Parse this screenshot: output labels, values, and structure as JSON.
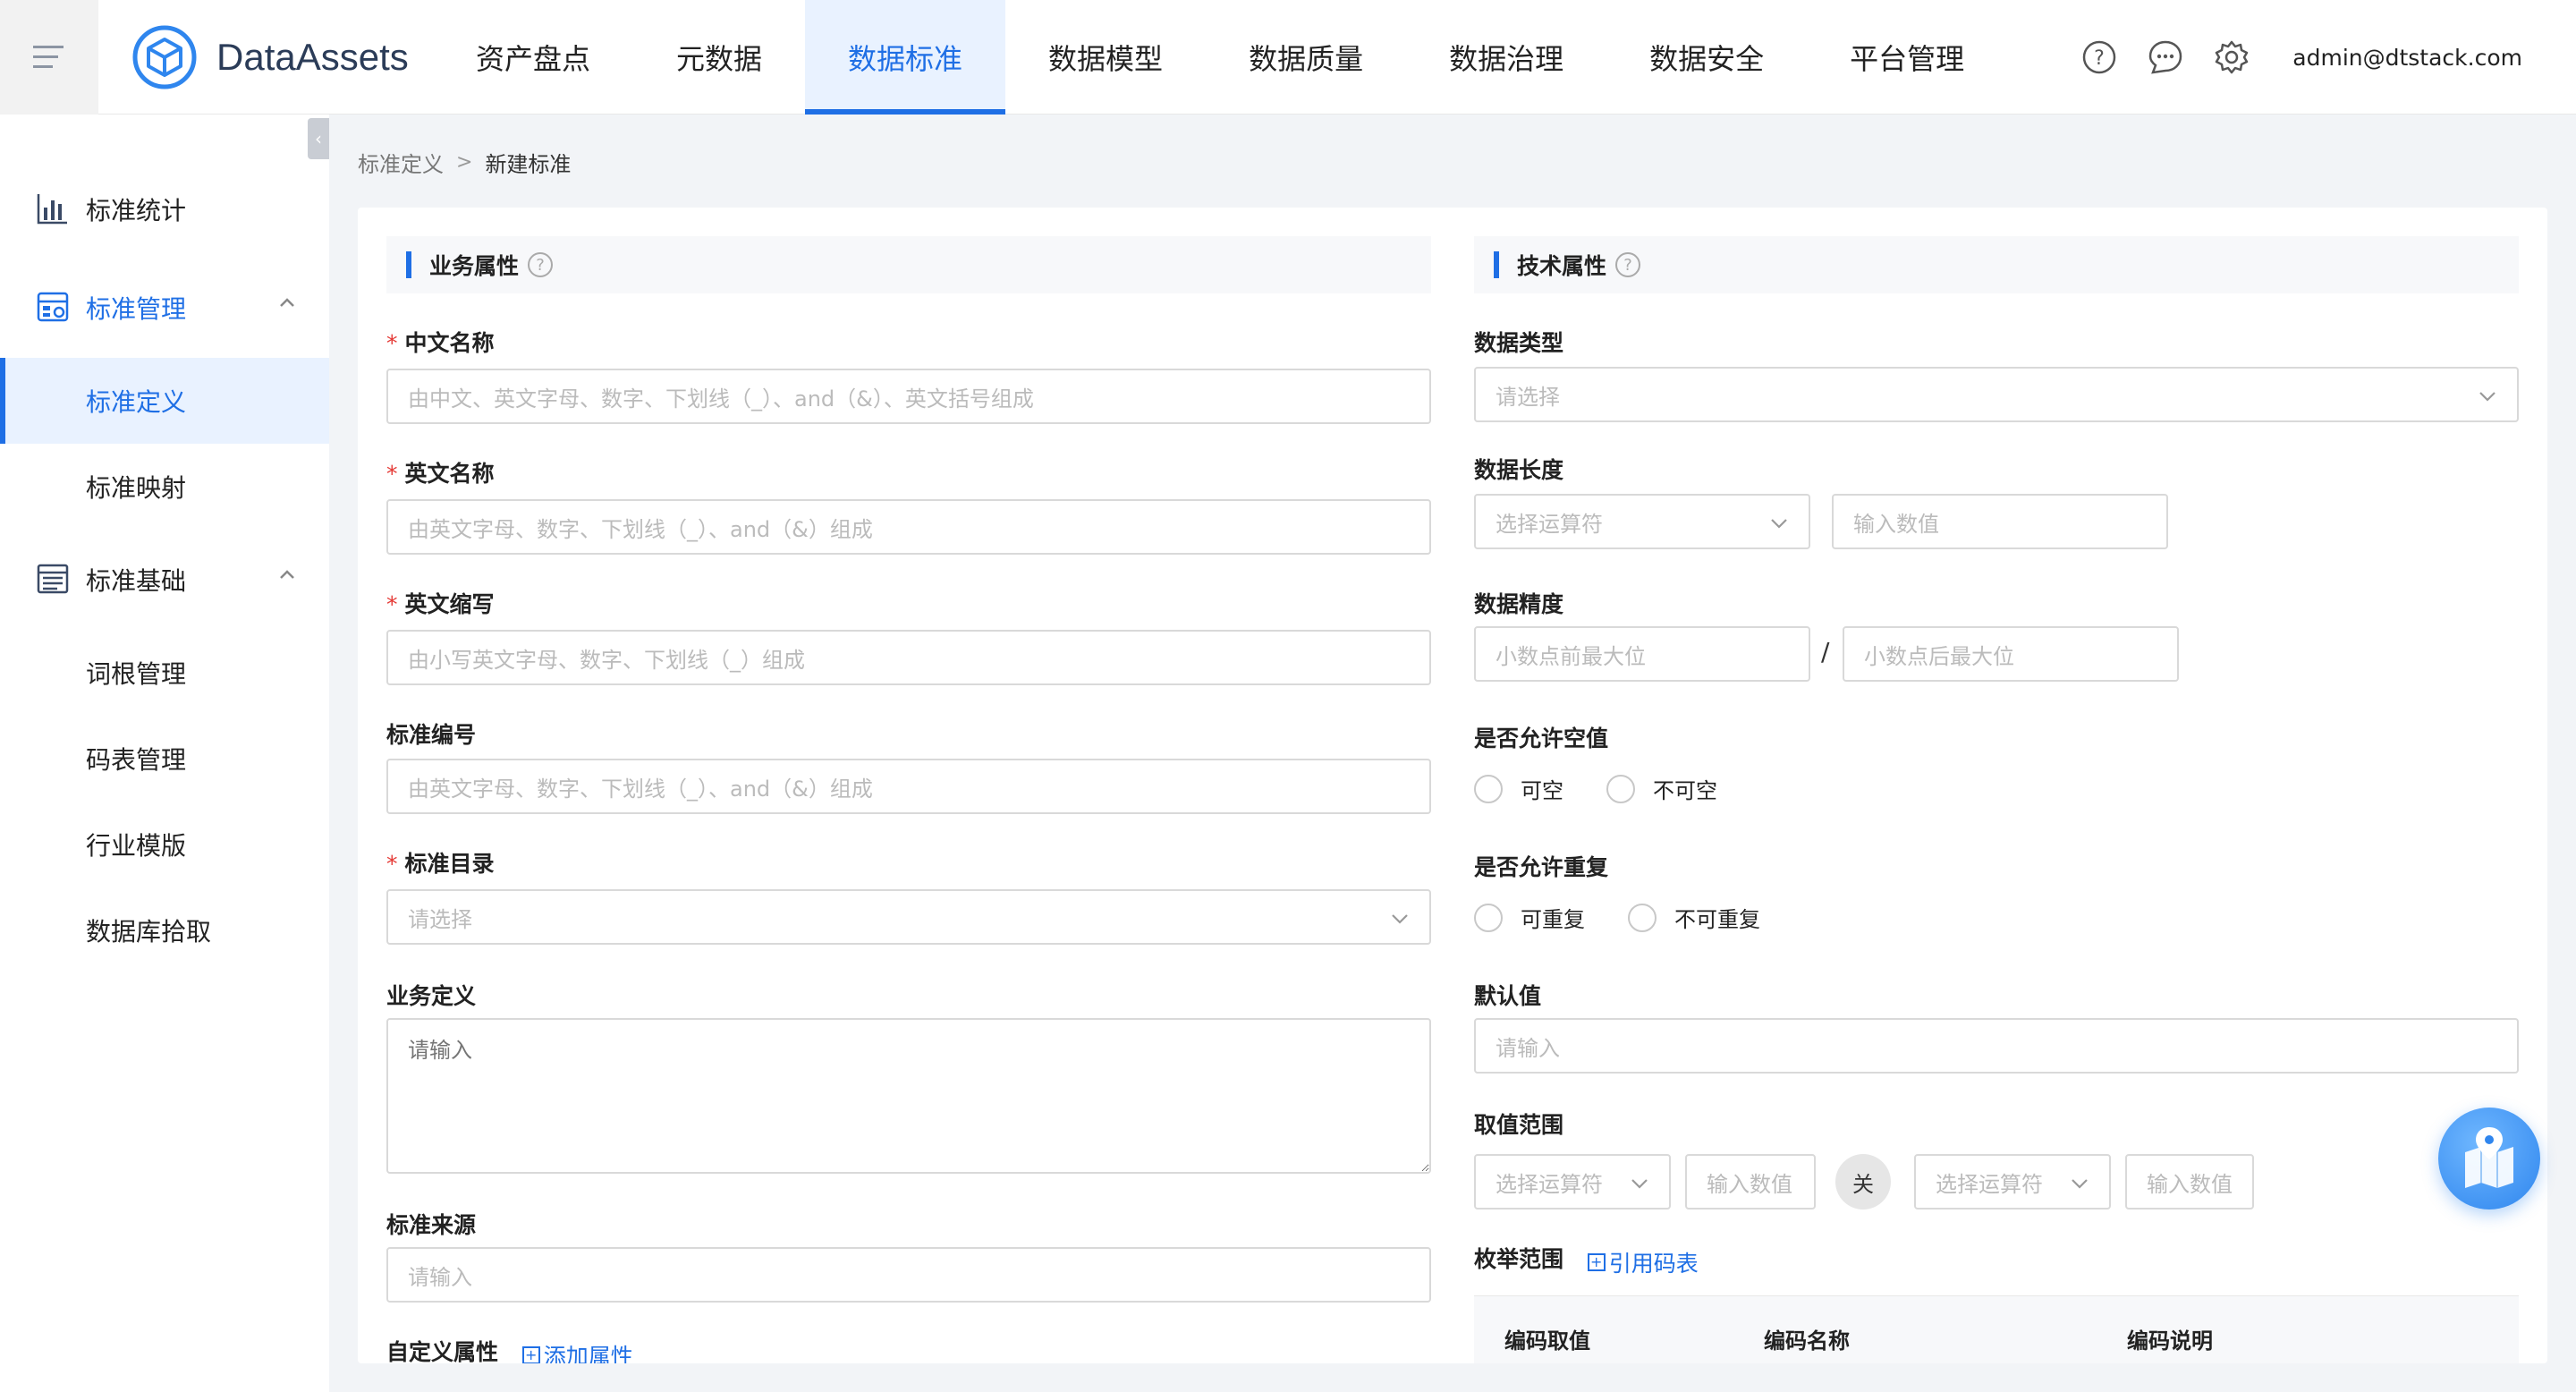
{
  "app": {
    "name": "DataAssets",
    "user": "admin@dtstack.com"
  },
  "nav": [
    "资产盘点",
    "元数据",
    "数据标准",
    "数据模型",
    "数据质量",
    "数据治理",
    "数据安全",
    "平台管理"
  ],
  "nav_active": "数据标准",
  "sidebar": {
    "items": [
      {
        "label": "标准统计"
      },
      {
        "label": "标准管理"
      },
      {
        "label": "标准定义"
      },
      {
        "label": "标准映射"
      },
      {
        "label": "标准基础"
      },
      {
        "label": "词根管理"
      },
      {
        "label": "码表管理"
      },
      {
        "label": "行业模版"
      },
      {
        "label": "数据库拾取"
      }
    ]
  },
  "breadcrumb": {
    "parent": "标准定义",
    "sep": ">",
    "current": "新建标准"
  },
  "business": {
    "title": "业务属性",
    "cn_name": {
      "label": "中文名称",
      "placeholder": "由中文、英文字母、数字、下划线（_）、and（&）、英文括号组成"
    },
    "en_name": {
      "label": "英文名称",
      "placeholder": "由英文字母、数字、下划线（_）、and（&）组成"
    },
    "en_abbr": {
      "label": "英文缩写",
      "placeholder": "由小写英文字母、数字、下划线（_）组成"
    },
    "std_code": {
      "label": "标准编号",
      "placeholder": "由英文字母、数字、下划线（_）、and（&）组成"
    },
    "std_dir": {
      "label": "标准目录",
      "placeholder": "请选择"
    },
    "biz_def": {
      "label": "业务定义",
      "placeholder": "请输入"
    },
    "std_source": {
      "label": "标准来源",
      "placeholder": "请输入"
    },
    "custom_attr": {
      "label": "自定义属性",
      "action": "添加属性"
    }
  },
  "tech": {
    "title": "技术属性",
    "data_type": {
      "label": "数据类型",
      "placeholder": "请选择"
    },
    "data_length": {
      "label": "数据长度",
      "op_placeholder": "选择运算符",
      "value_placeholder": "输入数值"
    },
    "data_precision": {
      "label": "数据精度",
      "before": "小数点前最大位",
      "sep": "/",
      "after": "小数点后最大位"
    },
    "nullable": {
      "label": "是否允许空值",
      "yes": "可空",
      "no": "不可空"
    },
    "repeatable": {
      "label": "是否允许重复",
      "yes": "可重复",
      "no": "不可重复"
    },
    "default_value": {
      "label": "默认值",
      "placeholder": "请输入"
    },
    "value_range": {
      "label": "取值范围",
      "op1": "选择运算符",
      "val1": "输入数值",
      "relation": "关",
      "op2": "选择运算符",
      "val2": "输入数值"
    },
    "enum_range": {
      "label": "枚举范围",
      "action": "引用码表"
    },
    "enum_table": {
      "columns": [
        "编码取值",
        "编码名称",
        "编码说明"
      ]
    }
  },
  "colors": {
    "accent": "#1f6fe5",
    "required": "#e53935"
  }
}
